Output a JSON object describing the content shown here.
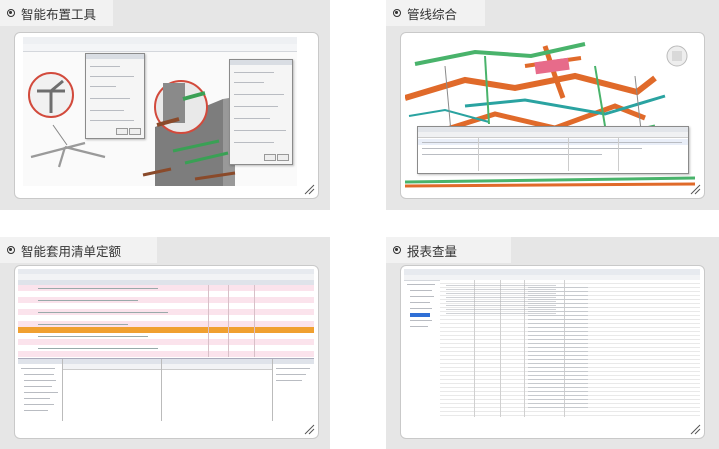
{
  "cards": [
    {
      "title": "智能布置工具"
    },
    {
      "title": "管线综合"
    },
    {
      "title": "智能套用清单定额"
    },
    {
      "title": "报表查量"
    }
  ]
}
